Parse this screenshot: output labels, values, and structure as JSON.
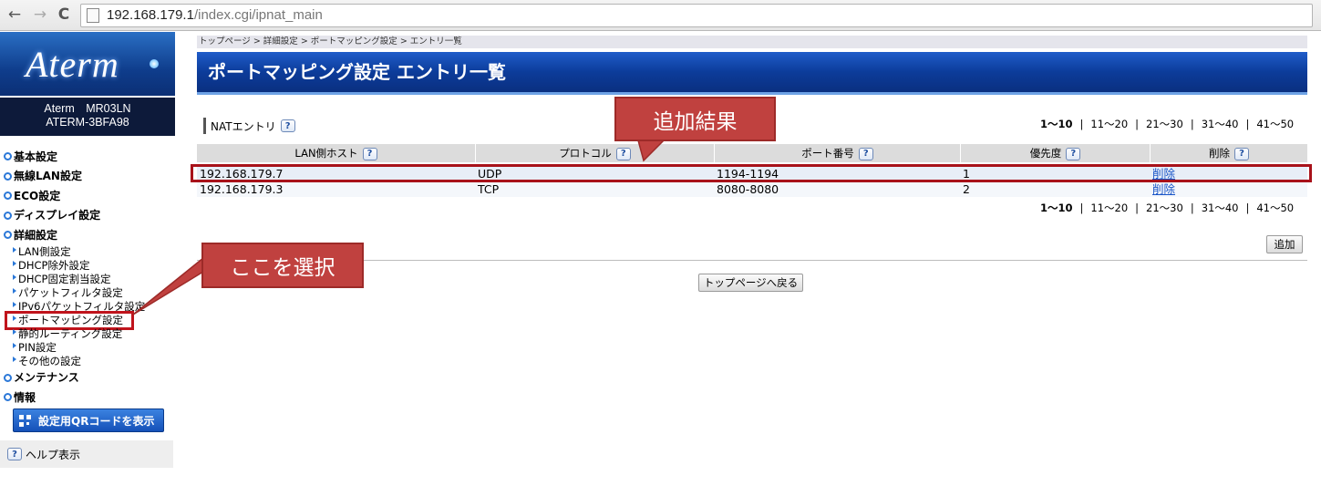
{
  "browser": {
    "url_host": "192.168.179.1",
    "url_path": "/index.cgi/ipnat_main"
  },
  "sidebar": {
    "logo": "Aterm",
    "model_line1": "Aterm　MR03LN",
    "model_line2": "ATERM-3BFA98",
    "menu": [
      {
        "label": "基本設定"
      },
      {
        "label": "無線LAN設定"
      },
      {
        "label": "ECO設定"
      },
      {
        "label": "ディスプレイ設定"
      },
      {
        "label": "詳細設定"
      }
    ],
    "submenu": [
      {
        "label": "LAN側設定"
      },
      {
        "label": "DHCP除外設定"
      },
      {
        "label": "DHCP固定割当設定"
      },
      {
        "label": "パケットフィルタ設定"
      },
      {
        "label": "IPv6パケットフィルタ設定"
      },
      {
        "label": "ポートマッピング設定"
      },
      {
        "label": "静的ルーティング設定"
      },
      {
        "label": "PIN設定"
      },
      {
        "label": "その他の設定"
      }
    ],
    "menu_bottom": [
      {
        "label": "メンテナンス"
      },
      {
        "label": "情報"
      }
    ],
    "qr_button": "設定用QRコードを表示",
    "help": "ヘルプ表示"
  },
  "main": {
    "breadcrumb": "トップページ > 詳細設定 > ポートマッピング設定 > エントリ一覧",
    "title": "ポートマッピング設定 エントリ一覧",
    "section_label": "NATエントリ",
    "help_mark": "?",
    "pager": [
      "1〜10",
      "11〜20",
      "21〜30",
      "31〜40",
      "41〜50"
    ],
    "pager_sep": "|",
    "columns": [
      "LAN側ホスト",
      "プロトコル",
      "ポート番号",
      "優先度",
      "削除"
    ],
    "rows": [
      {
        "host": "192.168.179.7",
        "protocol": "UDP",
        "port": "1194-1194",
        "priority": "1",
        "action": "削除"
      },
      {
        "host": "192.168.179.3",
        "protocol": "TCP",
        "port": "8080-8080",
        "priority": "2",
        "action": "削除"
      }
    ],
    "add_button": "追加",
    "back_button": "トップページへ戻る"
  },
  "annotations": {
    "result": "追加結果",
    "select": "ここを選択",
    "color": "#c0413f"
  }
}
